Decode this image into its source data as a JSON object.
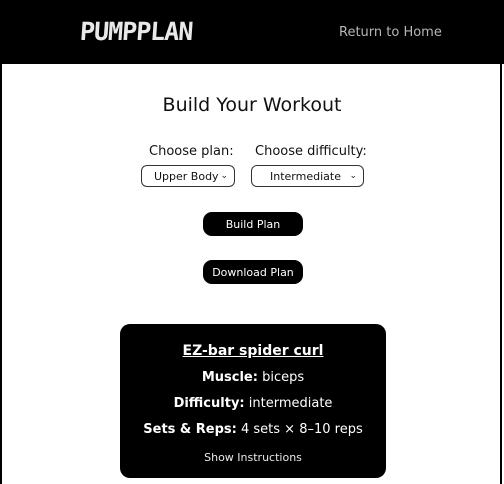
{
  "header": {
    "logo_text": "PUMPPLAN",
    "nav_home": "Return to Home"
  },
  "builder": {
    "title": "Build Your Workout",
    "plan_label": "Choose plan:",
    "plan_value": "Upper Body",
    "difficulty_label": "Choose difficulty:",
    "difficulty_value": "Intermediate",
    "build_button": "Build Plan",
    "download_button": "Download Plan"
  },
  "exercise": {
    "name": "EZ-bar spider curl",
    "muscle_label": "Muscle:",
    "muscle_value": "biceps",
    "difficulty_label": "Difficulty:",
    "difficulty_value": "intermediate",
    "sets_label": "Sets & Reps:",
    "sets_value": "4 sets × 8–10 reps",
    "show_instructions": "Show Instructions"
  },
  "colors": {
    "header_bg": "#000000",
    "card_bg": "#000000",
    "button_bg": "#000000"
  }
}
